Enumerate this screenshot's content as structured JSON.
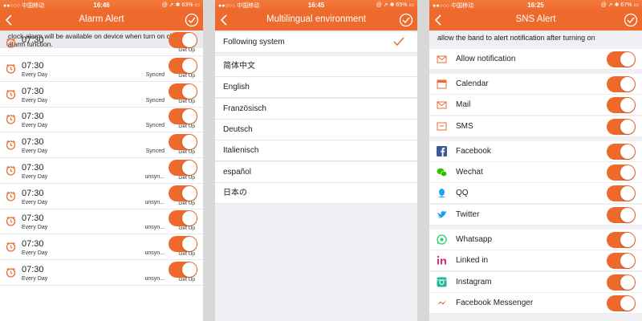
{
  "colors": {
    "accent": "#ee6a2c",
    "background": "#efeff4"
  },
  "alarm_screen": {
    "status": {
      "carrier": "●●○○○ 中国移动",
      "time": "16:46",
      "battery": "63%"
    },
    "title": "Alarm Alert",
    "notice": "clock alarm will be available on device when turn on clock alarm function.",
    "partial_row": {
      "time": "07:30",
      "label": "Get Up"
    },
    "alarms": [
      {
        "time": "07:30",
        "repeat": "Every Day",
        "sync": "Synced",
        "label": "Get Up",
        "enabled": true
      },
      {
        "time": "07:30",
        "repeat": "Every Day",
        "sync": "Synced",
        "label": "Get Up",
        "enabled": true
      },
      {
        "time": "07:30",
        "repeat": "Every Day",
        "sync": "Synced",
        "label": "Get Up",
        "enabled": true
      },
      {
        "time": "07:30",
        "repeat": "Every Day",
        "sync": "Synced",
        "label": "Get Up",
        "enabled": true
      },
      {
        "time": "07:30",
        "repeat": "Every Day",
        "sync": "unsyn...",
        "label": "Get Up",
        "enabled": true
      },
      {
        "time": "07:30",
        "repeat": "Every Day",
        "sync": "unsyn...",
        "label": "Get Up",
        "enabled": true
      },
      {
        "time": "07:30",
        "repeat": "Every Day",
        "sync": "unsyn...",
        "label": "Get Up",
        "enabled": true
      },
      {
        "time": "07:30",
        "repeat": "Every Day",
        "sync": "unsyn...",
        "label": "Get Up",
        "enabled": true
      },
      {
        "time": "07:30",
        "repeat": "Every Day",
        "sync": "unsyn...",
        "label": "Get Up",
        "enabled": true
      }
    ]
  },
  "language_screen": {
    "status": {
      "carrier": "●●○○○ 中国移动",
      "time": "16:45",
      "battery": "65%"
    },
    "title": "Multilingual environment",
    "selected": "Following system",
    "languages": [
      "简体中文",
      "English",
      "Französisch",
      "Deutsch",
      "Italienisch",
      "español",
      "日本の"
    ]
  },
  "sns_screen": {
    "status": {
      "carrier": "●●○○○ 中国移动",
      "time": "16:25",
      "battery": "67%"
    },
    "title": "SNS Alert",
    "notice": "allow the band to alert notification after turning on",
    "groups": [
      [
        {
          "label": "Allow notification",
          "icon": "envelope-icon",
          "color": "#ee6a2c",
          "enabled": true
        }
      ],
      [
        {
          "label": "Calendar",
          "icon": "calendar-icon",
          "color": "#ee6a2c",
          "enabled": true
        },
        {
          "label": "Mail",
          "icon": "mail-icon",
          "color": "#ee6a2c",
          "enabled": true
        },
        {
          "label": "SMS",
          "icon": "sms-icon",
          "color": "#ee6a2c",
          "enabled": true
        }
      ],
      [
        {
          "label": "Facebook",
          "icon": "facebook-icon",
          "color": "#3b5998",
          "enabled": true
        },
        {
          "label": "Wechat",
          "icon": "wechat-icon",
          "color": "#2dc100",
          "enabled": true
        },
        {
          "label": "QQ",
          "icon": "qq-icon",
          "color": "#1fa3ec",
          "enabled": true
        },
        {
          "label": "Twitter",
          "icon": "twitter-icon",
          "color": "#1da1f2",
          "enabled": true
        }
      ],
      [
        {
          "label": "Whatsapp",
          "icon": "whatsapp-icon",
          "color": "#25d366",
          "enabled": true
        },
        {
          "label": "Linked in",
          "icon": "linkedin-icon",
          "color": "#e0287c",
          "enabled": true
        },
        {
          "label": "Instagram",
          "icon": "instagram-icon",
          "color": "#1fb5a0",
          "enabled": true
        },
        {
          "label": "Facebook Messenger",
          "icon": "messenger-icon",
          "color": "#e8452c",
          "enabled": true
        }
      ]
    ]
  }
}
